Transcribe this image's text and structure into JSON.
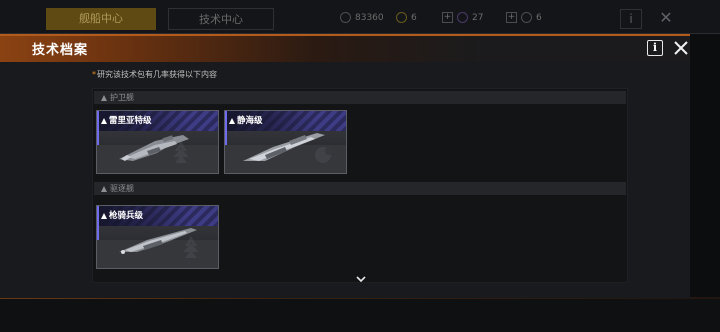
{
  "background": {
    "tabs": [
      {
        "label": "舰船中心",
        "active": true
      },
      {
        "label": "技术中心",
        "active": false
      }
    ],
    "resources": [
      {
        "icon": "credits-icon",
        "value": "83360"
      },
      {
        "icon": "metal-icon",
        "value": "6"
      },
      {
        "icon": "crystal-icon",
        "value": "27"
      },
      {
        "icon": "deuterium-icon",
        "value": "6"
      }
    ]
  },
  "dialog": {
    "title": "技术档案",
    "hint_star": "*",
    "hint": "研究该技术包有几率获得以下内容",
    "categories": [
      {
        "name": "护卫舰",
        "ships": [
          {
            "name": "雷里亚特级"
          },
          {
            "name": "静海级"
          }
        ]
      },
      {
        "name": "驱逐舰",
        "ships": [
          {
            "name": "枪骑兵级"
          }
        ]
      }
    ]
  },
  "colors": {
    "accent": "#b45a1a",
    "card_stripe": "#3f3c86",
    "card_edge": "#6f6cf0",
    "hint_star": "#e2891f"
  }
}
